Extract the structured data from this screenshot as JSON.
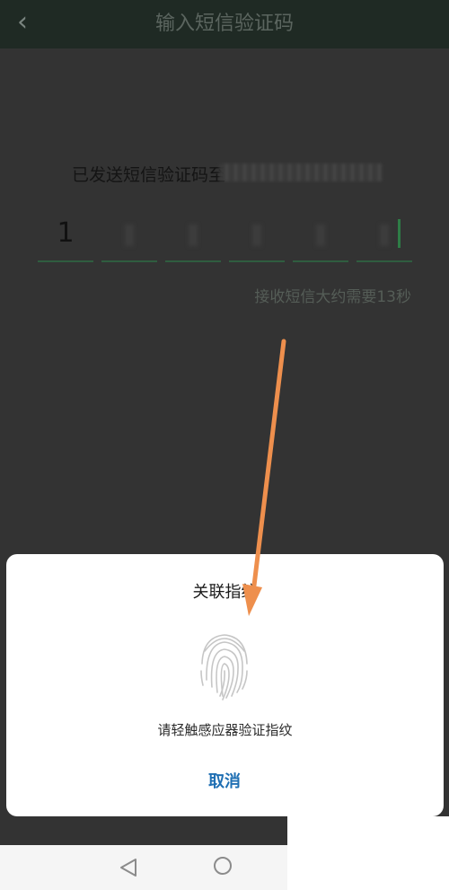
{
  "header": {
    "title": "输入短信验证码"
  },
  "sms": {
    "sent_prefix": "已发送短信验证码至",
    "code_digits": [
      "1",
      "",
      "",
      "",
      "",
      ""
    ],
    "receive_hint": "接收短信大约需要13秒"
  },
  "dialog": {
    "title": "关联指纹",
    "hint": "请轻触感应器验证指纹",
    "cancel_label": "取消"
  },
  "colors": {
    "accent_green": "#2e7d46",
    "cancel_blue": "#1f6fb3",
    "arrow_orange": "#ee8f4d"
  },
  "icons": {
    "back": "chevron-left-icon",
    "fingerprint": "fingerprint-icon",
    "nav_back": "triangle-back-icon",
    "nav_home": "circle-home-icon"
  }
}
